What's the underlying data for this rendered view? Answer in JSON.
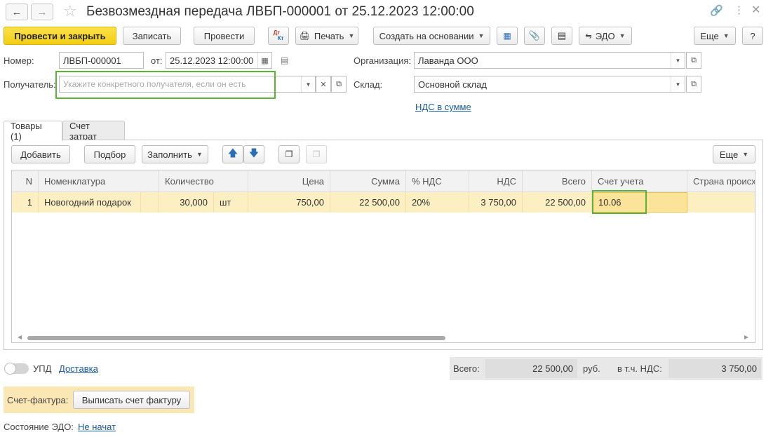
{
  "window": {
    "title": "Безвозмездная передача ЛВБП-000001 от 25.12.2023 12:00:00"
  },
  "toolbar": {
    "post_close": "Провести и закрыть",
    "save": "Записать",
    "post": "Провести",
    "dtkt_top": "Дт",
    "dtkt_bottom": "Кт",
    "print": "Печать",
    "create_based": "Создать на основании",
    "edo": "ЭДО",
    "more": "Еще",
    "help": "?"
  },
  "form": {
    "number_label": "Номер:",
    "number_value": "ЛВБП-000001",
    "date_label": "от:",
    "date_value": "25.12.2023 12:00:00",
    "recipient_label": "Получатель:",
    "recipient_placeholder": "Укажите конкретного получателя, если он есть",
    "org_label": "Организация:",
    "org_value": "Лаванда ООО",
    "warehouse_label": "Склад:",
    "warehouse_value": "Основной склад",
    "vat_link": "НДС в сумме"
  },
  "tabs": [
    {
      "label": "Товары (1)",
      "active": true
    },
    {
      "label": "Счет затрат",
      "active": false
    }
  ],
  "table_toolbar": {
    "add": "Добавить",
    "select": "Подбор",
    "fill": "Заполнить",
    "more": "Еще"
  },
  "table": {
    "columns": [
      "N",
      "Номенклатура",
      "Количество",
      "Цена",
      "Сумма",
      "% НДС",
      "НДС",
      "Всего",
      "Счет учета",
      "Страна происх"
    ],
    "rows": [
      {
        "n": "1",
        "name": "Новогодний подарок",
        "qty": "30,000",
        "unit": "шт",
        "price": "750,00",
        "sum": "22 500,00",
        "vat_rate": "20%",
        "vat": "3 750,00",
        "total": "22 500,00",
        "account": "10.06",
        "country": ""
      }
    ]
  },
  "footer": {
    "upd_label": "УПД",
    "delivery_link": "Доставка",
    "total_label": "Всего:",
    "total_value": "22 500,00",
    "currency": "руб.",
    "vat_label": "в т.ч. НДС:",
    "vat_value": "3 750,00",
    "invoice_label": "Счет-фактура:",
    "invoice_button": "Выписать счет фактуру",
    "edo_status_label": "Состояние ЭДО:",
    "edo_status_value": "Не начат"
  },
  "colors": {
    "primary_button": "#f5d31f",
    "selected_row": "#fcefc2",
    "highlight_frame": "#5db134",
    "link": "#1a5b9c"
  }
}
